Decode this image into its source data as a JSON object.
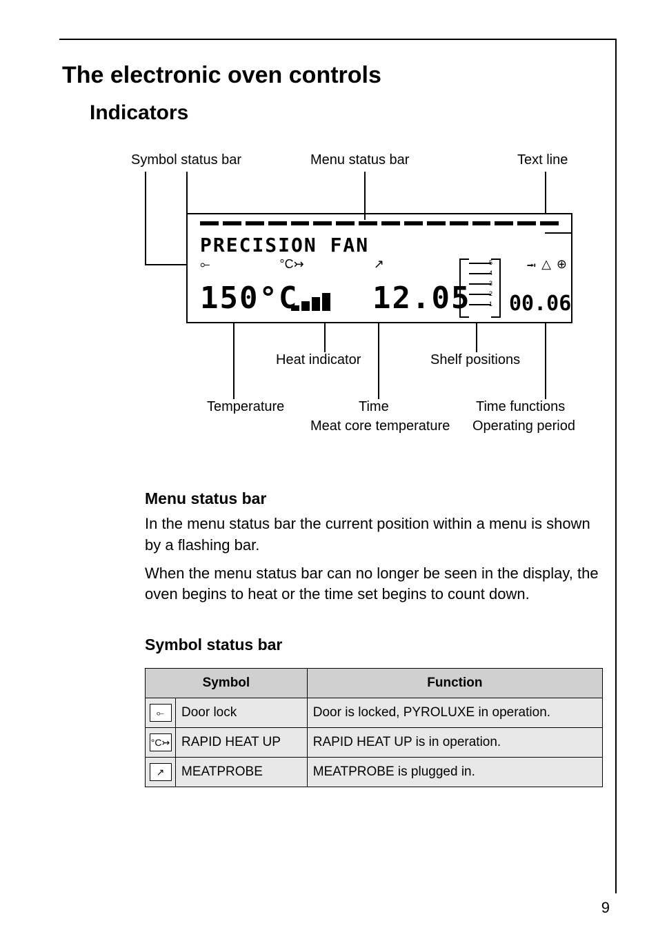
{
  "headings": {
    "h1": "The electronic oven controls",
    "h2": "Indicators",
    "menu_status": "Menu status bar",
    "symbol_status": "Symbol status bar"
  },
  "diagram_labels": {
    "symbol_status": "Symbol status bar",
    "menu_status": "Menu status bar",
    "text_line": "Text line",
    "heat_indicator": "Heat indicator",
    "shelf_positions": "Shelf positions",
    "temperature": "Temperature",
    "time": "Time",
    "meat_core": "Meat core temperature",
    "time_functions": "Time functions",
    "operating_period": "Operating period"
  },
  "display": {
    "mode_text": "PRECISION FAN",
    "temperature": "150°C",
    "clock": "12.05",
    "tf_time": "00.06",
    "shelf_levels": [
      "5",
      "4",
      "3",
      "2",
      "1"
    ]
  },
  "paragraphs": {
    "p1": "In the menu status bar the current position within a menu is shown by a flashing bar.",
    "p2": "When the menu status bar can no longer be seen in the display, the oven begins to heat or the time set begins to count down."
  },
  "table": {
    "head_symbol": "Symbol",
    "head_function": "Function",
    "rows": [
      {
        "icon": "⟜",
        "name": "Door lock",
        "func": "Door is locked, PYROLUXE in operation."
      },
      {
        "icon": "°C↣",
        "name": "RAPID HEAT UP",
        "func": "RAPID HEAT UP is in operation."
      },
      {
        "icon": "↗",
        "name": "MEATPROBE",
        "func": "MEATPROBE is plugged in."
      }
    ]
  },
  "page_number": "9"
}
